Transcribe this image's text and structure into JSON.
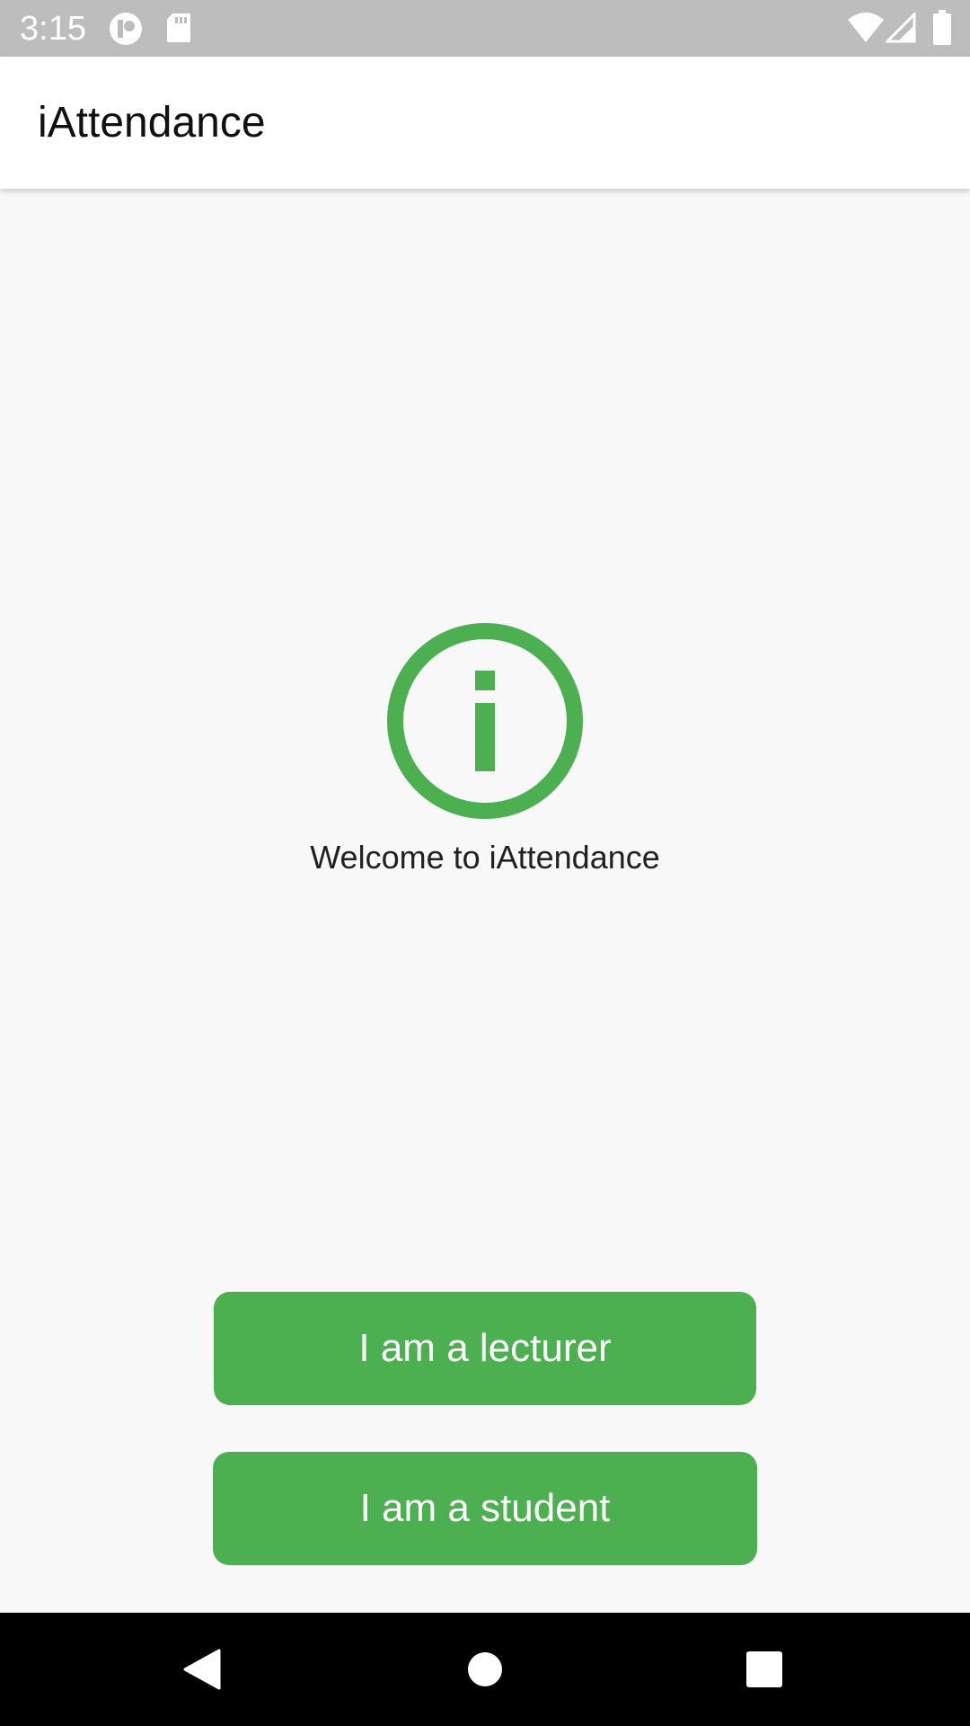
{
  "status_bar": {
    "time": "3:15",
    "left_icons": [
      "notification-app-icon",
      "sd-card-icon"
    ],
    "right_icons": [
      "wifi-icon",
      "cell-signal-icon",
      "battery-icon"
    ],
    "background_color": "#bdbdbd"
  },
  "app_bar": {
    "title": "iAttendance"
  },
  "main": {
    "icon": "info-icon",
    "icon_color": "#4caf50",
    "welcome_text": "Welcome to iAttendance"
  },
  "actions": {
    "lecturer_label": "I am a lecturer",
    "student_label": "I am a student",
    "button_color": "#4caf50"
  },
  "nav_bar": {
    "buttons": [
      "back-icon",
      "home-icon",
      "recents-icon"
    ]
  }
}
